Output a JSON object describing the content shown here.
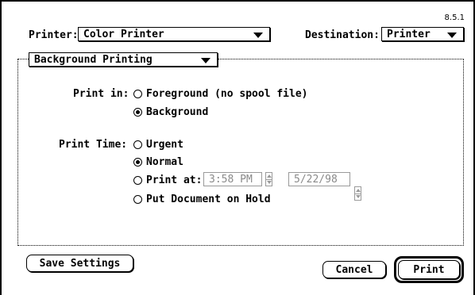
{
  "dialog": {
    "version": "8.5.1",
    "printer_label": "Printer:",
    "printer_value": "Color Printer",
    "destination_label": "Destination:",
    "destination_value": "Printer",
    "section_popup": "Background Printing"
  },
  "print_in": {
    "label": "Print in:",
    "options": [
      {
        "label": "Foreground (no spool file)",
        "selected": false
      },
      {
        "label": "Background",
        "selected": true
      }
    ]
  },
  "print_time": {
    "label": "Print Time:",
    "options": [
      {
        "label": "Urgent",
        "selected": false
      },
      {
        "label": "Normal",
        "selected": true
      },
      {
        "label": "Print at:",
        "selected": false
      },
      {
        "label": "Put Document on Hold",
        "selected": false
      }
    ],
    "time_value": "3:58 PM",
    "date_value": "5/22/98"
  },
  "buttons": {
    "save_settings": "Save Settings",
    "cancel": "Cancel",
    "print": "Print"
  }
}
